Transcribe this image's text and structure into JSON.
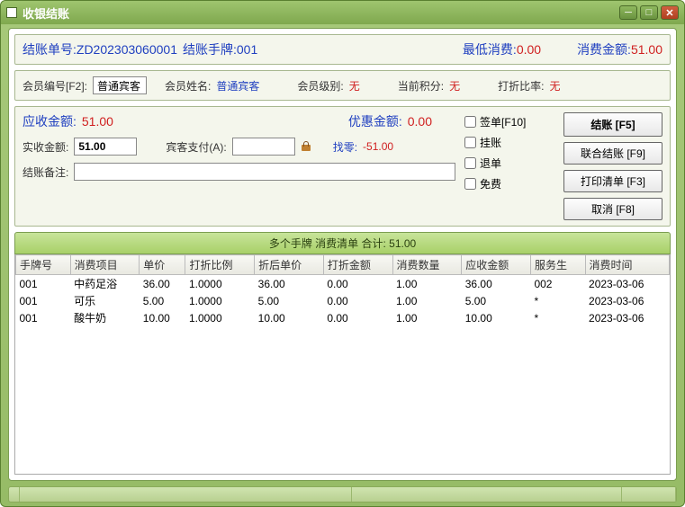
{
  "window": {
    "title": "收银结账"
  },
  "header": {
    "bill_label": "结账单号:",
    "bill_no": "ZD202303060001",
    "card_label": "结账手牌:",
    "card_no": "001",
    "min_label": "最低消费:",
    "min_value": "0.00",
    "amount_label": "消费金额:",
    "amount_value": "51.00"
  },
  "member": {
    "id_label": "会员编号[F2]:",
    "id_value": "普通宾客",
    "name_label": "会员姓名:",
    "name_value": "普通宾客",
    "level_label": "会员级别:",
    "level_value": "无",
    "points_label": "当前积分:",
    "points_value": "无",
    "discount_label": "打折比率:",
    "discount_value": "无"
  },
  "pay": {
    "receivable_label": "应收金额:",
    "receivable_value": "51.00",
    "discount_label": "优惠金额:",
    "discount_value": "0.00",
    "paid_label": "实收金额:",
    "paid_value": "51.00",
    "guest_label": "宾客支付(A):",
    "guest_value": "",
    "change_label": "找零:",
    "change_value": "-51.00",
    "remark_label": "结账备注:",
    "remark_value": ""
  },
  "checks": {
    "sign": "签单[F10]",
    "credit": "挂账",
    "refund": "退单",
    "free": "免费"
  },
  "buttons": {
    "checkout": "结账 [F5]",
    "union": "联合结账 [F9]",
    "print": "打印清单 [F3]",
    "cancel": "取消 [F8]"
  },
  "table": {
    "title": "多个手牌  消费清单  合计: 51.00",
    "cols": [
      "手牌号",
      "消费项目",
      "单价",
      "打折比例",
      "折后单价",
      "打折金额",
      "消费数量",
      "应收金额",
      "服务生",
      "消费时间"
    ],
    "rows": [
      [
        "001",
        "中药足浴",
        "36.00",
        "1.0000",
        "36.00",
        "0.00",
        "1.00",
        "36.00",
        "002",
        "2023-03-06"
      ],
      [
        "001",
        "可乐",
        "5.00",
        "1.0000",
        "5.00",
        "0.00",
        "1.00",
        "5.00",
        "*",
        "2023-03-06"
      ],
      [
        "001",
        "酸牛奶",
        "10.00",
        "1.0000",
        "10.00",
        "0.00",
        "1.00",
        "10.00",
        "*",
        "2023-03-06"
      ]
    ]
  }
}
